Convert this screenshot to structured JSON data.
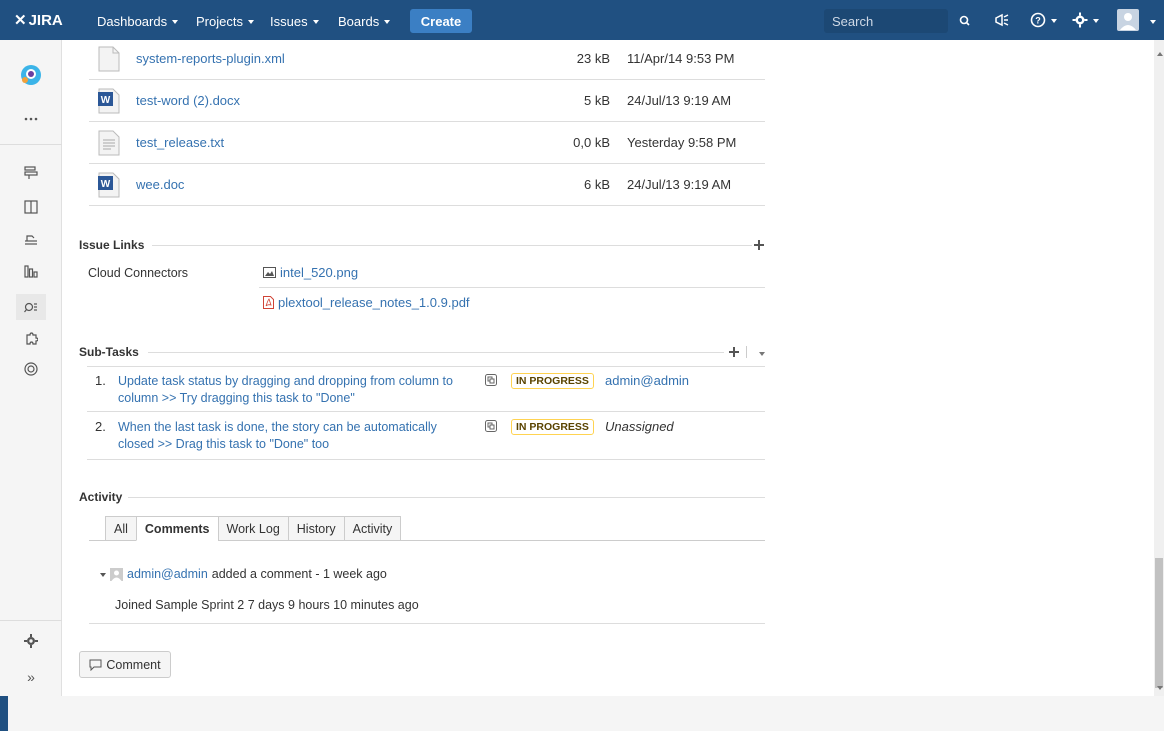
{
  "nav": {
    "logo": "JIRA",
    "items": [
      {
        "label": "Dashboards"
      },
      {
        "label": "Projects"
      },
      {
        "label": "Issues"
      },
      {
        "label": "Boards"
      }
    ],
    "create_label": "Create",
    "search_placeholder": "Search"
  },
  "attachments": [
    {
      "name": "system-reports-plugin.xml",
      "size": "23 kB",
      "date": "11/Apr/14 9:53 PM",
      "icon": "file-icon"
    },
    {
      "name": "test-word (2).docx",
      "size": "5 kB",
      "date": "24/Jul/13 9:19 AM",
      "icon": "word-icon"
    },
    {
      "name": "test_release.txt",
      "size": "0,0 kB",
      "date": "Yesterday 9:58 PM",
      "icon": "text-file-icon"
    },
    {
      "name": "wee.doc",
      "size": "6 kB",
      "date": "24/Jul/13 9:19 AM",
      "icon": "word-icon"
    }
  ],
  "issue_links": {
    "title": "Issue Links",
    "group_label": "Cloud Connectors",
    "items": [
      {
        "label": "intel_520.png",
        "icon": "image-icon"
      },
      {
        "label": "plextool_release_notes_1.0.9.pdf",
        "icon": "pdf-icon"
      }
    ]
  },
  "subtasks": {
    "title": "Sub-Tasks",
    "items": [
      {
        "num": "1.",
        "text": "Update task status by dragging and dropping from column to column >> Try dragging this task to \"Done\"",
        "status": "IN PROGRESS",
        "assignee": "admin@admin"
      },
      {
        "num": "2.",
        "text": "When the last task is done, the story can be automatically closed >> Drag this task to \"Done\" too",
        "status": "IN PROGRESS",
        "assignee": "Unassigned"
      }
    ]
  },
  "activity": {
    "title": "Activity",
    "tabs": [
      "All",
      "Comments",
      "Work Log",
      "History",
      "Activity"
    ],
    "active_tab": "Comments",
    "comment": {
      "author": "admin@admin",
      "action": "added a comment - 1 week ago",
      "body": "Joined Sample Sprint 2 7 days 9 hours 10 minutes ago"
    },
    "comment_button": "Comment"
  }
}
